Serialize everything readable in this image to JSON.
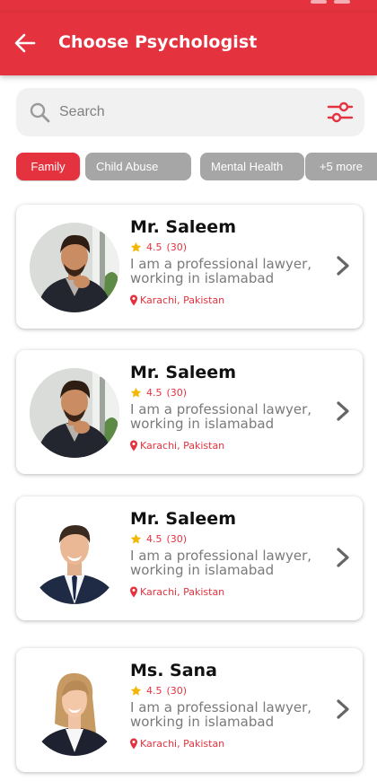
{
  "header": {
    "title": "Choose Psychologist"
  },
  "search": {
    "placeholder": "Search"
  },
  "chips": [
    {
      "label": "Family",
      "active": true
    },
    {
      "label": "Child Abuse",
      "active": false
    },
    {
      "label": "Mental Health",
      "active": false
    },
    {
      "label": "+5 more",
      "active": false
    }
  ],
  "psychologists": [
    {
      "name": "Mr. Saleem",
      "rating": "4.5",
      "reviews": "(30)",
      "description": "I am a professional lawyer, working in islamabad",
      "location": "Karachi, Pakistan"
    },
    {
      "name": "Mr. Saleem",
      "rating": "4.5",
      "reviews": "(30)",
      "description": "I am a professional lawyer, working in islamabad",
      "location": "Karachi, Pakistan"
    },
    {
      "name": "Mr. Saleem",
      "rating": "4.5",
      "reviews": "(30)",
      "description": "I am a professional lawyer, working in islamabad",
      "location": "Karachi, Pakistan"
    },
    {
      "name": "Ms. Sana",
      "rating": "4.5",
      "reviews": "(30)",
      "description": "I am a professional lawyer, working in islamabad",
      "location": "Karachi, Pakistan"
    }
  ],
  "icons": {
    "back": "arrow-left-icon",
    "search": "search-icon",
    "filter": "sliders-icon",
    "star": "star-icon",
    "location": "map-pin-icon",
    "chevron": "chevron-right-icon"
  },
  "colors": {
    "brand": "#e4323f",
    "chip_inactive": "#a6a6a6",
    "star": "#f2b705",
    "text_muted": "#7a7a7a"
  }
}
